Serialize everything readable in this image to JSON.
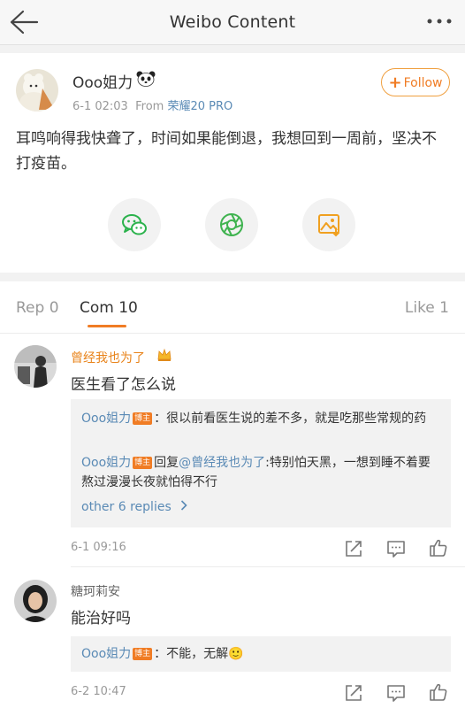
{
  "header": {
    "title": "Weibo Content"
  },
  "post": {
    "author": "Ooo姐力",
    "author_emoji": "🐼",
    "date": "6-1 02:03",
    "from_prefix": "From ",
    "device": "荣耀20 PRO",
    "follow_label": "Follow",
    "text": "耳鸣响得我快聋了，时间如果能倒退，我想回到一周前，坚决不打疫苗。"
  },
  "tabs": {
    "reposts": "Rep 0",
    "comments": "Com 10",
    "likes": "Like 1"
  },
  "comments": [
    {
      "name": "曾经我也为了",
      "text": "医生看了怎么说",
      "replies": [
        {
          "author": "Ooo姐力",
          "badge": "博主",
          "sep": "：",
          "text": "很以前看医生说的差不多，就是吃那些常规的药"
        },
        {
          "author": "Ooo姐力",
          "badge": "博主",
          "reply_prefix": "回复",
          "mention": "@曾经我也为了",
          "text": ":特别怕天黑，一想到睡不着要熬过漫漫长夜就怕得不行"
        }
      ],
      "other_replies": "other 6 replies",
      "time": "6-1 09:16"
    },
    {
      "name": "糖珂莉安",
      "text": "能治好吗",
      "replies": [
        {
          "author": "Ooo姐力",
          "badge": "博主",
          "sep": "：",
          "text": "不能，无解🙂"
        }
      ],
      "time": "6-2 10:47"
    }
  ],
  "colors": {
    "accent": "#f07c24",
    "link": "#5a8ab5",
    "wechat_green": "#2bb24c",
    "moments_green": "#3fb34f"
  }
}
